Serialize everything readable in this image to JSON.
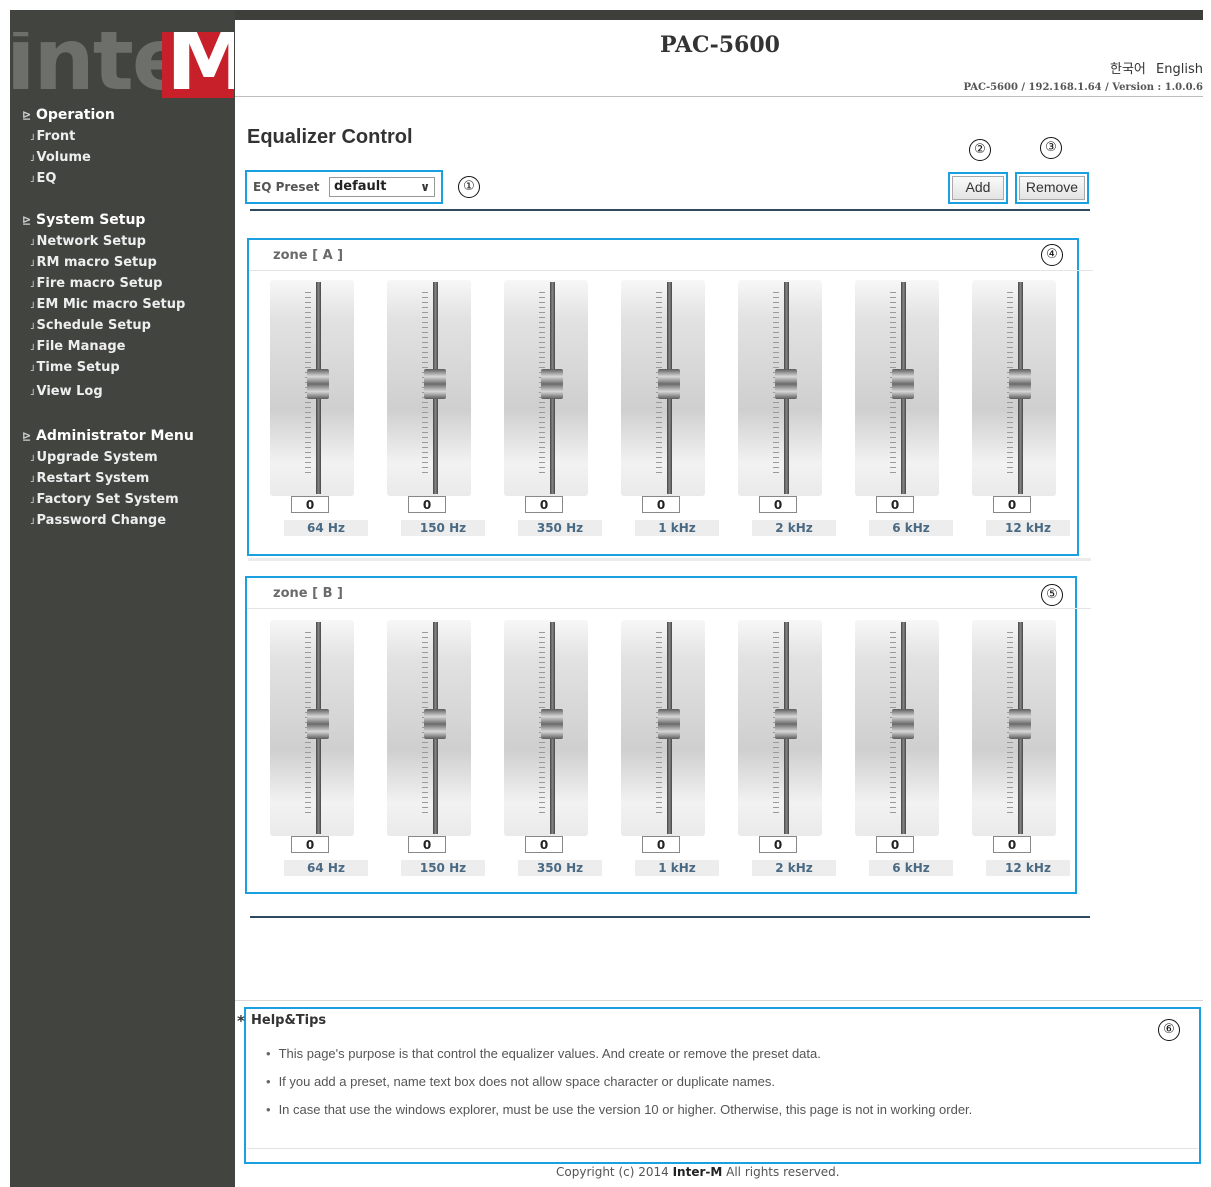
{
  "app": {
    "title": "PAC-5600",
    "lang_korean": "한국어",
    "lang_english": "English",
    "version_info": "PAC-5600 / 192.168.1.64 / Version : 1.0.0.6",
    "logo_text": "inter",
    "logo_accent": "M"
  },
  "sidebar": {
    "groups": [
      {
        "label": "Operation",
        "items": [
          "Front",
          "Volume",
          "EQ"
        ]
      },
      {
        "label": "System Setup",
        "items": [
          "Network Setup",
          "RM macro Setup",
          "Fire macro Setup",
          "EM Mic macro Setup",
          "Schedule Setup",
          "File Manage",
          "Time Setup",
          "View Log"
        ]
      },
      {
        "label": "Administrator Menu",
        "items": [
          "Upgrade System",
          "Restart System",
          "Factory Set System",
          "Password Change"
        ]
      }
    ]
  },
  "main": {
    "heading": "Equalizer Control",
    "preset_label": "EQ Preset",
    "preset_value": "default",
    "add_label": "Add",
    "remove_label": "Remove"
  },
  "callouts": [
    "①",
    "②",
    "③",
    "④",
    "⑤",
    "⑥"
  ],
  "zones": [
    {
      "title": "zone [ A ]",
      "bands": [
        {
          "value": "0",
          "freq": "64 Hz"
        },
        {
          "value": "0",
          "freq": "150 Hz"
        },
        {
          "value": "0",
          "freq": "350 Hz"
        },
        {
          "value": "0",
          "freq": "1 kHz"
        },
        {
          "value": "0",
          "freq": "2 kHz"
        },
        {
          "value": "0",
          "freq": "6 kHz"
        },
        {
          "value": "0",
          "freq": "12 kHz"
        }
      ]
    },
    {
      "title": "zone [ B ]",
      "bands": [
        {
          "value": "0",
          "freq": "64 Hz"
        },
        {
          "value": "0",
          "freq": "150 Hz"
        },
        {
          "value": "0",
          "freq": "350 Hz"
        },
        {
          "value": "0",
          "freq": "1 kHz"
        },
        {
          "value": "0",
          "freq": "2 kHz"
        },
        {
          "value": "0",
          "freq": "6 kHz"
        },
        {
          "value": "0",
          "freq": "12 kHz"
        }
      ]
    }
  ],
  "help": {
    "star": "*",
    "title": "Help&Tips",
    "tips": [
      "This page's purpose is that control the equalizer values. And create or remove the preset data.",
      "If you add a preset, name text box does not allow space character or duplicate names.",
      "In case that use the windows explorer, must be use the version 10 or higher. Otherwise, this page is not in working order."
    ]
  },
  "footer": {
    "prefix": "Copyright (c) 2014 ",
    "brand": "Inter-M",
    "suffix": " All rights reserved."
  },
  "colors": {
    "sidebar_bg": "#424440",
    "accent_red": "#c8202a",
    "callout_border": "#1aa0e0",
    "freq_label": "#4a6a84"
  },
  "icons": {
    "group_marker": "menu-group-icon",
    "item_bullet": "bullet-icon",
    "select_arrow": "chevron-down-icon"
  }
}
